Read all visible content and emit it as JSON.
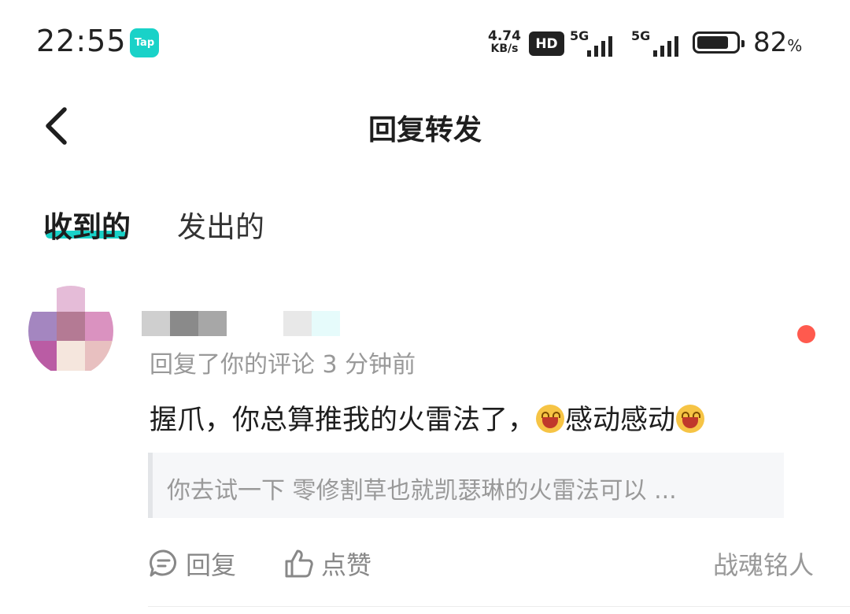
{
  "status_bar": {
    "time": "22:55",
    "app_badge": "Tap",
    "net_speed_value": "4.74",
    "net_speed_unit": "KB/s",
    "hd_label": "HD",
    "sim1_label": "5G",
    "sim2_label": "5G",
    "battery_percent": "82",
    "battery_percent_sign": "%",
    "battery_level": 0.82
  },
  "header": {
    "title": "回复转发",
    "back_icon": "chevron-left-icon"
  },
  "tabs": [
    {
      "label": "收到的",
      "active": true
    },
    {
      "label": "发出的",
      "active": false
    }
  ],
  "notification": {
    "meta": "回复了你的评论 3 分钟前",
    "reply_part1": "握爪，你总算推我的火雷法了，",
    "reply_part2": "感动感动",
    "quoted": "你去试一下 零修割草也就凯瑟琳的火雷法可以 ...",
    "actions": {
      "reply_label": "回复",
      "like_label": "点赞"
    },
    "signature": "战魂铭人",
    "unread": true
  },
  "colors": {
    "accent": "#19d2c8",
    "unread_dot": "#ff5a4e",
    "secondary_text": "#999999"
  }
}
